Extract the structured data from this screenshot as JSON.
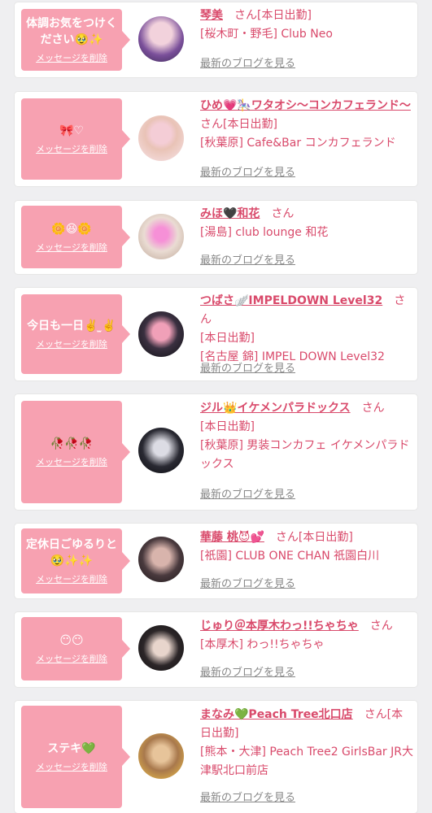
{
  "colors": {
    "bubble": "#f7a1b1",
    "accent_text": "#d94a6b",
    "link_gray": "#888888",
    "background": "#efeff1"
  },
  "cards": [
    {
      "message": "体調お気をつけください🥹✨",
      "delete_label": "メッセージを削除",
      "name": "琴美",
      "name_suffix": "さん[本日出勤]",
      "shop": "[桜木町・野毛] Club Neo",
      "blog_link": "最新のブログを見る",
      "avatar_icon": "avatar-photo",
      "avatar_colors": [
        "#6b4a8c",
        "#e9c6d6"
      ]
    },
    {
      "message": "🎀♡",
      "delete_label": "メッセージを削除",
      "name": "ひめ💗🎠ワタオシ〜コンカフェランド〜",
      "name_suffix": "さん[本日出勤]",
      "shop": "[秋葉原] Cafe&Bar コンカフェランド",
      "blog_link": "最新のブログを見る",
      "avatar_icon": "avatar-photo",
      "avatar_colors": [
        "#f3dbe1",
        "#c79c8e"
      ]
    },
    {
      "message": "🌼😆🌼",
      "delete_label": "メッセージを削除",
      "name": "みほ🖤和花",
      "name_suffix": "さん",
      "shop": "[湯島] club lounge 和花",
      "blog_link": "最新のブログを見る",
      "avatar_icon": "avatar-photo",
      "avatar_colors": [
        "#e9d9cf",
        "#f39bd8"
      ]
    },
    {
      "message": "今日も一日✌️ ̫✌️",
      "delete_label": "メッセージを削除",
      "name": "つばさ🪽IMPELDOWN Level32",
      "name_suffix": "さん",
      "shop_lines": [
        "[本日出勤]",
        "[名古屋 錦] IMPEL DOWN Level32"
      ],
      "blog_link": "最新のブログを見る",
      "avatar_icon": "avatar-photo",
      "avatar_colors": [
        "#1c1c24",
        "#e58ca8"
      ]
    },
    {
      "message": "🥀🥀🥀",
      "delete_label": "メッセージを削除",
      "name": "ジル👑イケメンパラドックス",
      "name_suffix": "さん",
      "shop_lines": [
        "[本日出勤]",
        "[秋葉原] 男装コンカフェ イケメンパラドックス"
      ],
      "blog_link": "最新のブログを見る",
      "avatar_icon": "avatar-photo",
      "avatar_colors": [
        "#0d0d12",
        "#d9d9e0"
      ]
    },
    {
      "message": "定休日ごゆるりと🥹✨✨",
      "delete_label": "メッセージを削除",
      "name": "華藤 桃😈💕",
      "name_suffix": "さん[本日出勤]",
      "shop": "[祇園] CLUB ONE CHAN 祇園白川",
      "blog_link": "最新のブログを見る",
      "avatar_icon": "avatar-photo",
      "avatar_colors": [
        "#2a2226",
        "#c9a7a0"
      ]
    },
    {
      "message": "😶😶",
      "delete_label": "メッセージを削除",
      "name": "じゅり＠本厚木わっ!!ちゃちゃ",
      "name_suffix": "さん",
      "shop": "[本厚木] わっ!!ちゃちゃ",
      "blog_link": "最新のブログを見る",
      "avatar_icon": "avatar-photo",
      "avatar_colors": [
        "#1f1c1e",
        "#e4d3cc"
      ]
    },
    {
      "message": "ステキ💚",
      "delete_label": "メッセージを削除",
      "name": "まなみ💚Peach Tree北口店",
      "name_suffix": "さん[本日出勤]",
      "shop": "[熊本・大津] Peach Tree2 GirlsBar JR大津駅北口前店",
      "blog_link": "最新のブログを見る",
      "avatar_icon": "avatar-photo",
      "avatar_colors": [
        "#b98a5c",
        "#f1c34a"
      ]
    }
  ]
}
